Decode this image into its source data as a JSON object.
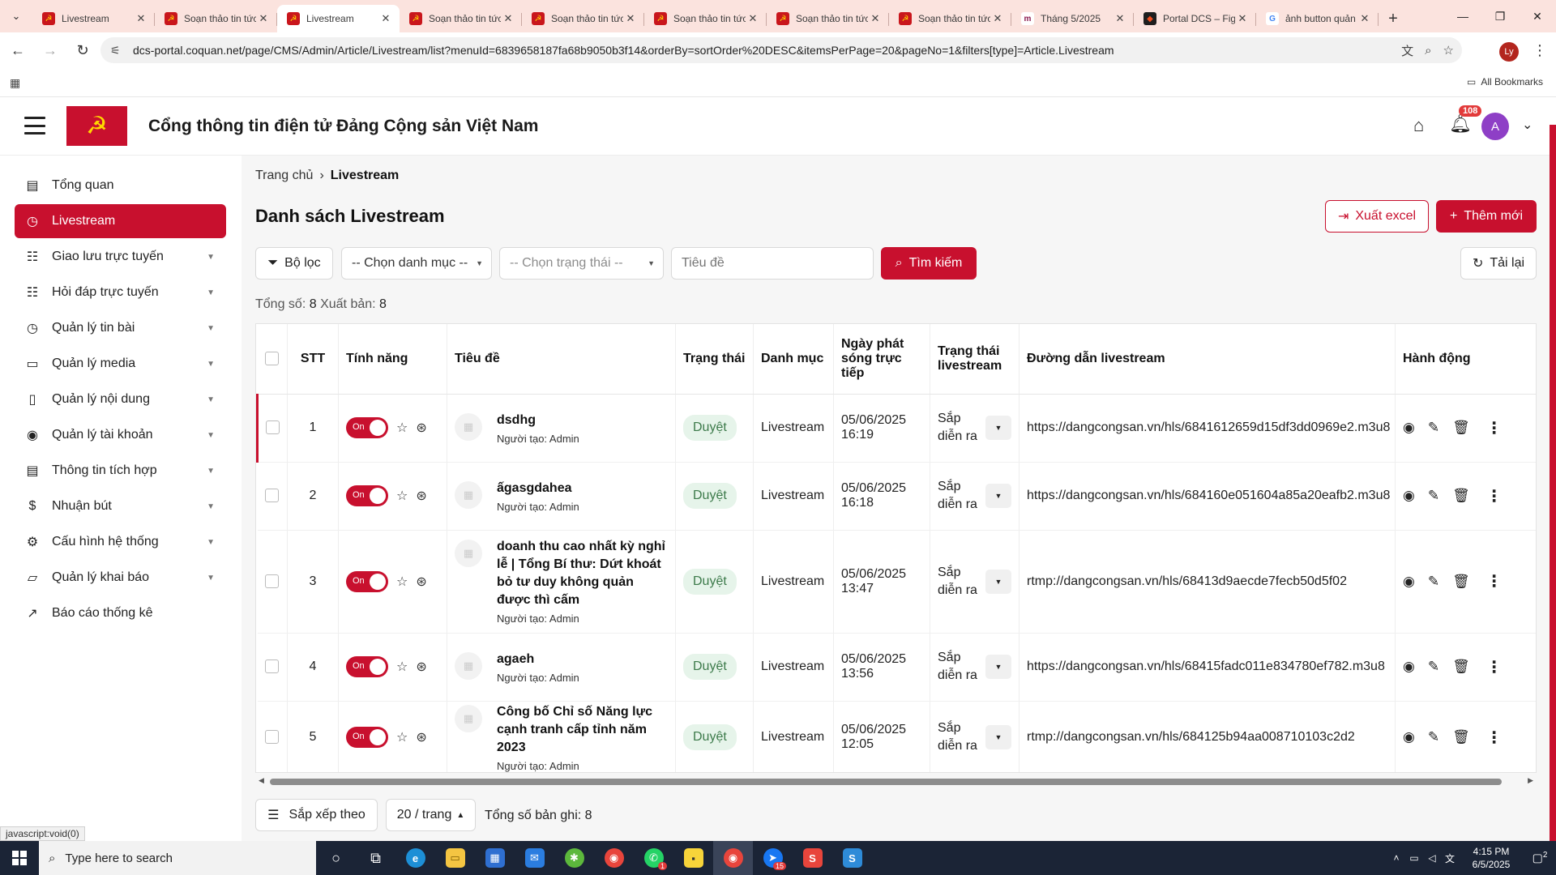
{
  "browser": {
    "tabs": [
      {
        "title": "Livestream",
        "active": false,
        "fav": "party"
      },
      {
        "title": "Soạn thảo tin tức",
        "active": false,
        "fav": "party"
      },
      {
        "title": "Livestream",
        "active": true,
        "fav": "party"
      },
      {
        "title": "Soạn thảo tin tức",
        "active": false,
        "fav": "party"
      },
      {
        "title": "Soạn thảo tin tức",
        "active": false,
        "fav": "party"
      },
      {
        "title": "Soạn thảo tin tức",
        "active": false,
        "fav": "party"
      },
      {
        "title": "Soạn thảo tin tức",
        "active": false,
        "fav": "party"
      },
      {
        "title": "Soạn thảo tin tức",
        "active": false,
        "fav": "party"
      },
      {
        "title": "Tháng 5/2025",
        "active": false,
        "fav": "m"
      },
      {
        "title": "Portal DCS – Figma",
        "active": false,
        "fav": "fig"
      },
      {
        "title": "ảnh button quản lý",
        "active": false,
        "fav": "g"
      }
    ],
    "url": "dcs-portal.coquan.net/page/CMS/Admin/Article/Livestream/list?menuId=6839658187fa68b9050b3f14&orderBy=sortOrder%20DESC&itemsPerPage=20&pageNo=1&filters[type]=Article.Livestream",
    "profile_initial": "Ly",
    "all_bookmarks": "All Bookmarks"
  },
  "header": {
    "site_title": "Cổng thông tin điện tử Đảng Cộng sản Việt Nam",
    "notifications": "108",
    "avatar_initial": "A"
  },
  "sidebar": {
    "items": [
      {
        "label": "Tổng quan",
        "icon": "▤",
        "has_children": false,
        "active": false
      },
      {
        "label": "Livestream",
        "icon": "◷",
        "has_children": false,
        "active": true
      },
      {
        "label": "Giao lưu trực tuyến",
        "icon": "☷",
        "has_children": true,
        "active": false
      },
      {
        "label": "Hỏi đáp trực tuyến",
        "icon": "☷",
        "has_children": true,
        "active": false
      },
      {
        "label": "Quản lý tin bài",
        "icon": "◷",
        "has_children": true,
        "active": false
      },
      {
        "label": "Quản lý media",
        "icon": "▭",
        "has_children": true,
        "active": false
      },
      {
        "label": "Quản lý nội dung",
        "icon": "▯",
        "has_children": true,
        "active": false
      },
      {
        "label": "Quản lý tài khoản",
        "icon": "◉",
        "has_children": true,
        "active": false
      },
      {
        "label": "Thông tin tích hợp",
        "icon": "▤",
        "has_children": true,
        "active": false
      },
      {
        "label": "Nhuận bút",
        "icon": "$",
        "has_children": true,
        "active": false
      },
      {
        "label": "Cấu hình hệ thống",
        "icon": "⚙",
        "has_children": true,
        "active": false
      },
      {
        "label": "Quản lý khai báo",
        "icon": "▱",
        "has_children": true,
        "active": false
      },
      {
        "label": "Báo cáo thống kê",
        "icon": "↗",
        "has_children": false,
        "active": false
      }
    ]
  },
  "breadcrumb": {
    "home": "Trang chủ",
    "current": "Livestream"
  },
  "page": {
    "title": "Danh sách Livestream",
    "export_label": "Xuất excel",
    "add_label": "Thêm mới"
  },
  "filters": {
    "filter_label": "Bộ lọc",
    "category_select": "-- Chọn danh mục --",
    "status_select": "-- Chọn trạng thái --",
    "title_placeholder": "Tiêu đề",
    "search_label": "Tìm kiếm",
    "reload_label": "Tải lại"
  },
  "summary": {
    "total_label": "Tổng số:",
    "total": "8",
    "published_label": "Xuất bản:",
    "published": "8"
  },
  "table": {
    "headers": [
      "STT",
      "Tính năng",
      "Tiêu đề",
      "Trạng thái",
      "Danh mục",
      "Ngày phát sóng trực tiếp",
      "Trạng thái livestream",
      "Đường dẫn livestream",
      "Hành động"
    ],
    "toggle_label": "On",
    "rows": [
      {
        "stt": "1",
        "title": "dsdhg",
        "creator": "Người tạo: Admin",
        "status": "Duyệt",
        "category": "Livestream",
        "date": "05/06/2025",
        "time": "16:19",
        "ls_status": "Sắp diễn ra",
        "url": "https://dangcongsan.vn/hls/6841612659d15df3dd0969e2.m3u8"
      },
      {
        "stt": "2",
        "title": "ấgasgdahea",
        "creator": "Người tạo: Admin",
        "status": "Duyệt",
        "category": "Livestream",
        "date": "05/06/2025",
        "time": "16:18",
        "ls_status": "Sắp diễn ra",
        "url": "https://dangcongsan.vn/hls/684160e051604a85a20eafb2.m3u8"
      },
      {
        "stt": "3",
        "title": "doanh thu cao nhất kỳ nghỉ lễ | Tổng Bí thư: Dứt khoát bỏ tư duy không quản được thì cấm",
        "creator": "Người tạo: Admin",
        "status": "Duyệt",
        "category": "Livestream",
        "date": "05/06/2025",
        "time": "13:47",
        "ls_status": "Sắp diễn ra",
        "url": "rtmp://dangcongsan.vn/hls/68413d9aecde7fecb50d5f02"
      },
      {
        "stt": "4",
        "title": "agaeh",
        "creator": "Người tạo: Admin",
        "status": "Duyệt",
        "category": "Livestream",
        "date": "05/06/2025",
        "time": "13:56",
        "ls_status": "Sắp diễn ra",
        "url": "https://dangcongsan.vn/hls/68415fadc011e834780ef782.m3u8"
      },
      {
        "stt": "5",
        "title": "Công bố Chỉ số Năng lực cạnh tranh cấp tỉnh năm 2023",
        "creator": "Người tạo: Admin",
        "status": "Duyệt",
        "category": "Livestream",
        "date": "05/06/2025",
        "time": "12:05",
        "ls_status": "Sắp diễn ra",
        "url": "rtmp://dangcongsan.vn/hls/684125b94aa008710103c2d2"
      }
    ]
  },
  "footer": {
    "sort_label": "Sắp xếp theo",
    "per_page": "20 / trang",
    "total_records": "Tổng số bản ghi: 8"
  },
  "status_tip": "javascript:void(0)",
  "taskbar": {
    "search_placeholder": "Type here to search",
    "time": "4:15 PM",
    "date": "6/5/2025",
    "notifications": "2"
  }
}
